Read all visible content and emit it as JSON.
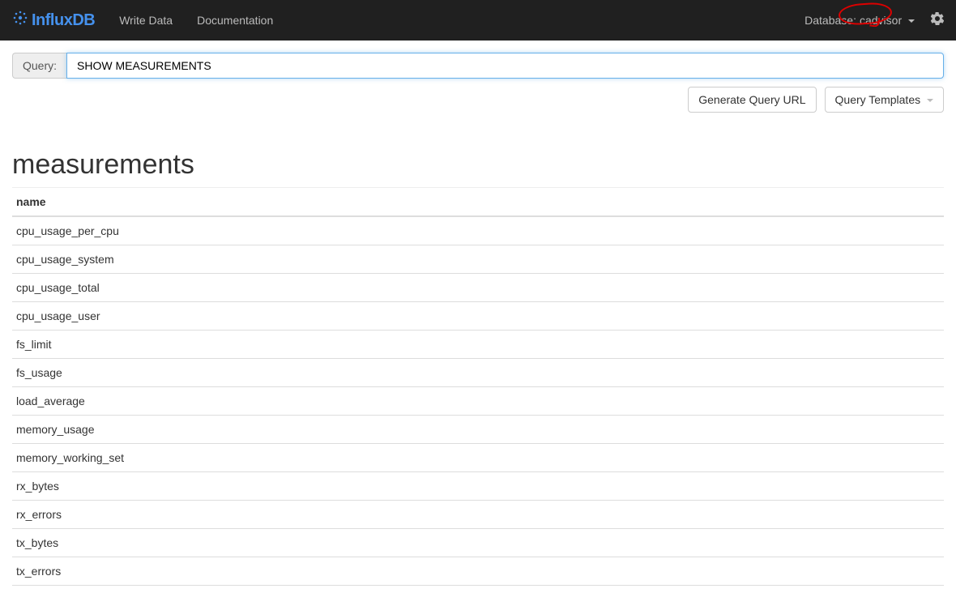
{
  "navbar": {
    "brand": "InfluxDB",
    "links": [
      "Write Data",
      "Documentation"
    ],
    "database_label": "Database:",
    "database_name": "cadvisor"
  },
  "query": {
    "label": "Query:",
    "value": "SHOW MEASUREMENTS"
  },
  "buttons": {
    "generate_url": "Generate Query URL",
    "templates": "Query Templates"
  },
  "results": {
    "title": "measurements",
    "column_header": "name",
    "rows": [
      "cpu_usage_per_cpu",
      "cpu_usage_system",
      "cpu_usage_total",
      "cpu_usage_user",
      "fs_limit",
      "fs_usage",
      "load_average",
      "memory_usage",
      "memory_working_set",
      "rx_bytes",
      "rx_errors",
      "tx_bytes",
      "tx_errors"
    ]
  }
}
